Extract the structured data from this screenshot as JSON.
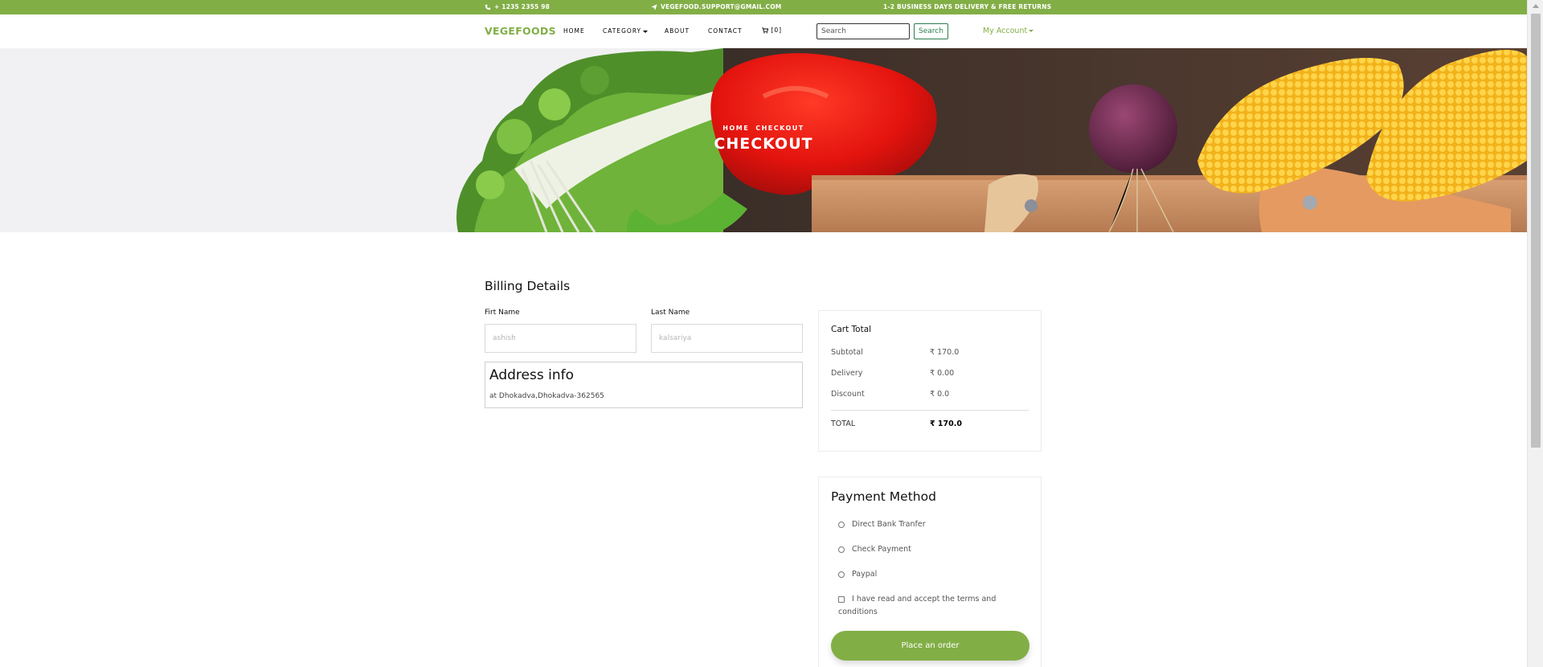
{
  "topbar": {
    "phone": "+ 1235 2355 98",
    "email": "VEGEFOOD.SUPPORT@GMAIL.COM",
    "promo": "1-2 BUSINESS DAYS DELIVERY & FREE RETURNS"
  },
  "navbar": {
    "brand": "VEGEFOODS",
    "links": [
      "HOME",
      "CATEGORY",
      "ABOUT",
      "CONTACT"
    ],
    "cart_count": "[0]",
    "search_placeholder": "Search",
    "search_button": "Search",
    "account": "My Account"
  },
  "hero": {
    "breadcrumb": [
      "HOME",
      "CHECKOUT"
    ],
    "title": "CHECKOUT"
  },
  "billing": {
    "title": "Billing Details",
    "first_name_label": "Firt Name",
    "first_name_placeholder": "ashish",
    "last_name_label": "Last Name",
    "last_name_placeholder": "kalsariya",
    "address_title": "Address info",
    "address_text": "at Dhokadva,Dhokadva-362565"
  },
  "cart": {
    "title": "Cart Total",
    "rows": [
      {
        "label": "Subtotal",
        "value": "₹ 170.0"
      },
      {
        "label": "Delivery",
        "value": "₹ 0.00"
      },
      {
        "label": "Discount",
        "value": "₹ 0.0"
      }
    ],
    "total_label": "TOTAL",
    "total_value": "₹ 170.0"
  },
  "payment": {
    "title": "Payment Method",
    "options": [
      "Direct Bank Tranfer",
      "Check Payment",
      "Paypal"
    ],
    "terms": "I have read and accept the terms and conditions",
    "order_button": "Place an order"
  },
  "colors": {
    "accent": "#82ae46",
    "search_button_border": "#2e7d4f"
  },
  "icons": [
    "phone-icon",
    "paper-plane-icon",
    "cart-icon"
  ]
}
